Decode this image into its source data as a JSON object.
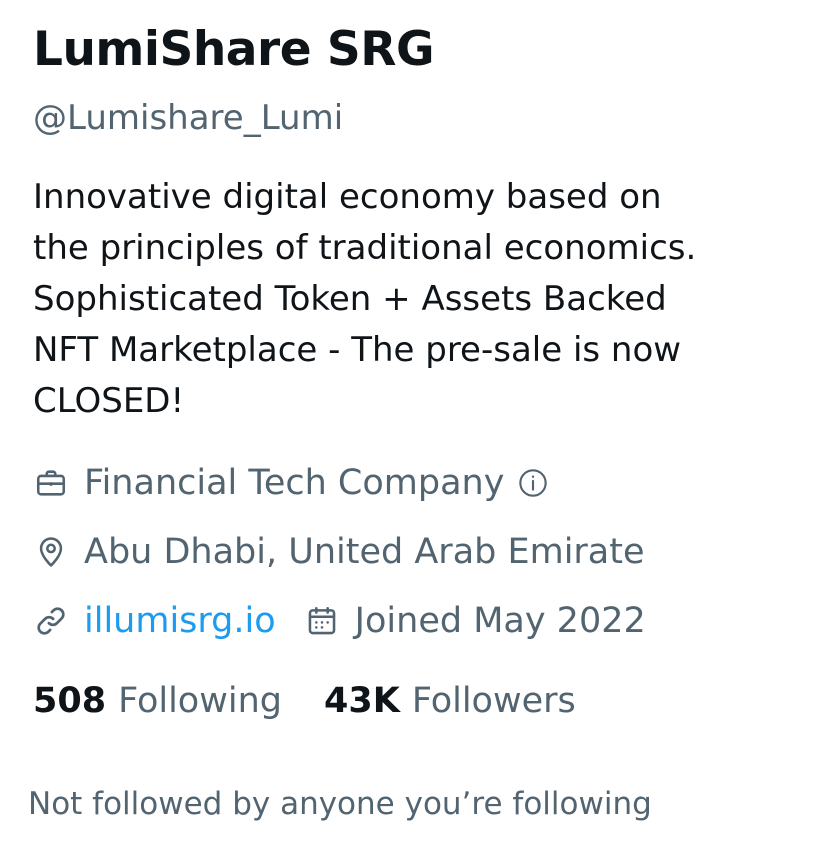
{
  "profile": {
    "name": "LumiShare SRG",
    "handle": "@Lumishare_Lumi",
    "bio": "Innovative digital economy based on\nthe principles of traditional economics.\nSophisticated Token + Assets Backed\nNFT Marketplace - The pre-sale is now\nCLOSED!",
    "category": "Financial Tech Company",
    "location": "Abu Dhabi, United Arab Emirate",
    "website": "illumisrg.io",
    "joined": "Joined May 2022",
    "following_count": "508",
    "following_label": "Following",
    "followers_count": "43K",
    "followers_label": "Followers",
    "mutuals_text": "Not followed by anyone you’re following"
  },
  "icons": {
    "category": "briefcase-icon",
    "category_info": "info-icon",
    "location": "location-pin-icon",
    "website": "link-icon",
    "joined": "calendar-icon"
  },
  "colors": {
    "primary_text": "#0f1419",
    "secondary_text": "#536471",
    "link": "#1d9bf0"
  }
}
